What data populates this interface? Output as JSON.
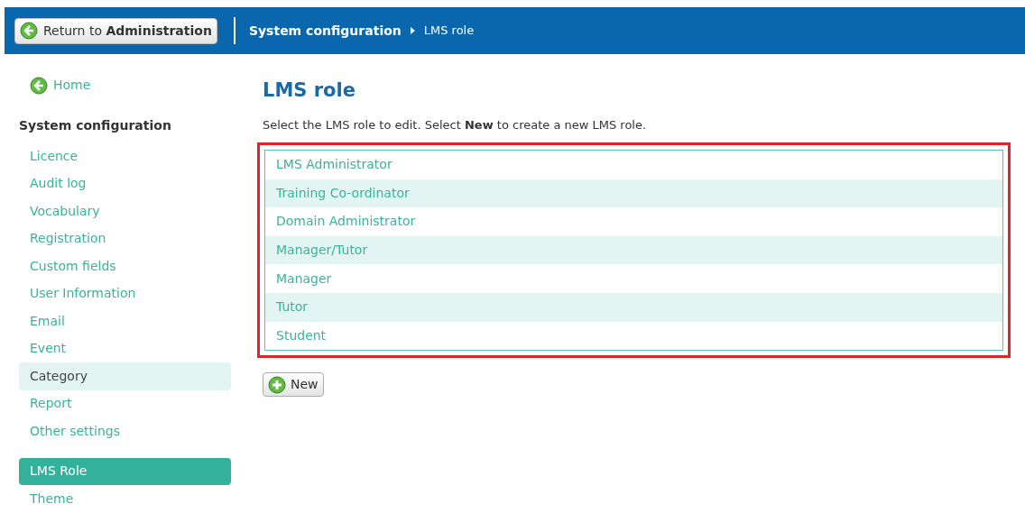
{
  "header": {
    "return_button": "Return to **Administration**",
    "breadcrumb": [
      "System configuration",
      "LMS role"
    ]
  },
  "sidebar": {
    "home": "Home",
    "section_title": "System configuration",
    "items": [
      {
        "label": "Licence",
        "selected": false,
        "highlighted": false
      },
      {
        "label": "Audit log",
        "selected": false,
        "highlighted": false
      },
      {
        "label": "Vocabulary",
        "selected": false,
        "highlighted": false
      },
      {
        "label": "Registration",
        "selected": false,
        "highlighted": false
      },
      {
        "label": "Custom fields",
        "selected": false,
        "highlighted": false
      },
      {
        "label": "User Information",
        "selected": false,
        "highlighted": false
      },
      {
        "label": "Email",
        "selected": false,
        "highlighted": false
      },
      {
        "label": "Event",
        "selected": false,
        "highlighted": false
      },
      {
        "label": "Category",
        "selected": false,
        "highlighted": true
      },
      {
        "label": "Report",
        "selected": false,
        "highlighted": false
      },
      {
        "label": "Other settings",
        "selected": false,
        "highlighted": false
      }
    ],
    "items_2": [
      {
        "label": "LMS Role",
        "selected": true,
        "highlighted": false
      },
      {
        "label": "Theme",
        "selected": false,
        "highlighted": false
      }
    ]
  },
  "main": {
    "title": "LMS role",
    "instruction": "Select the LMS role to edit. Select **New** to create a new LMS role.",
    "roles": [
      "LMS Administrator",
      "Training Co-ordinator",
      "Domain Administrator",
      "Manager/Tutor",
      "Manager",
      "Tutor",
      "Student"
    ],
    "new_button": "New"
  }
}
